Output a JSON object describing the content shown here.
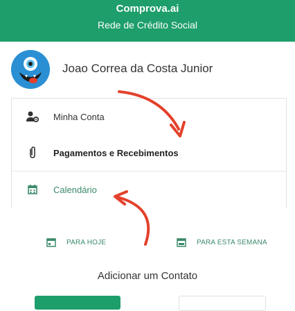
{
  "header": {
    "title": "Comprova.ai",
    "subtitle": "Rede de Crédito Social"
  },
  "profile": {
    "name": "Joao Correa da Costa Junior",
    "avatar_icon": "monster-avatar-icon"
  },
  "menu": {
    "items": [
      {
        "label": "Minha Conta",
        "icon": "user-gear-icon"
      },
      {
        "label": "Pagamentos e Recebimentos",
        "icon": "paperclip-icon"
      },
      {
        "label": "Calendário",
        "icon": "calendar-icon"
      }
    ]
  },
  "quick_links": [
    {
      "label": "PARA HOJE",
      "icon": "calendar-icon"
    },
    {
      "label": "PARA ESTA SEMANA",
      "icon": "calendar-icon"
    }
  ],
  "add_contact": {
    "title": "Adicionar um Contato"
  },
  "colors": {
    "brand": "#1e9e6b",
    "accent_text": "#3c8a6a",
    "arrow": "#e4412b"
  }
}
